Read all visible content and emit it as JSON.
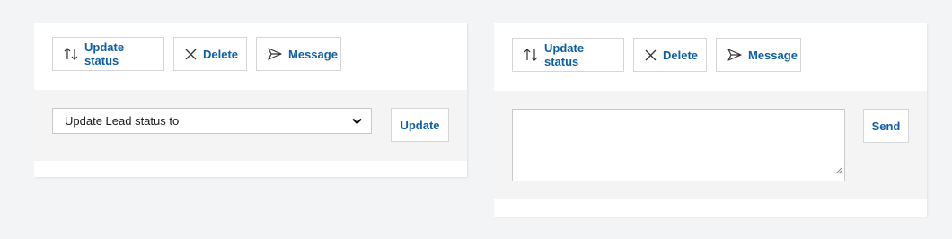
{
  "colors": {
    "page_background": "#f3f4f6",
    "panel_background": "#ffffff",
    "band_background": "#f4f4f4",
    "accent_text": "#0f5fa6",
    "border": "#d6d6d6"
  },
  "left_panel": {
    "actions": {
      "update_status": {
        "label": "Update status",
        "icon": "sort-arrows-icon"
      },
      "delete": {
        "label": "Delete",
        "icon": "close-icon"
      },
      "message": {
        "label": "Message",
        "icon": "send-icon"
      }
    },
    "status_select": {
      "value": "Update Lead status to",
      "icon": "chevron-down-icon"
    },
    "update_button": {
      "label": "Update"
    }
  },
  "right_panel": {
    "actions": {
      "update_status": {
        "label": "Update status",
        "icon": "sort-arrows-icon"
      },
      "delete": {
        "label": "Delete",
        "icon": "close-icon"
      },
      "message": {
        "label": "Message",
        "icon": "send-icon"
      }
    },
    "message_textarea": {
      "value": ""
    },
    "send_button": {
      "label": "Send"
    }
  }
}
